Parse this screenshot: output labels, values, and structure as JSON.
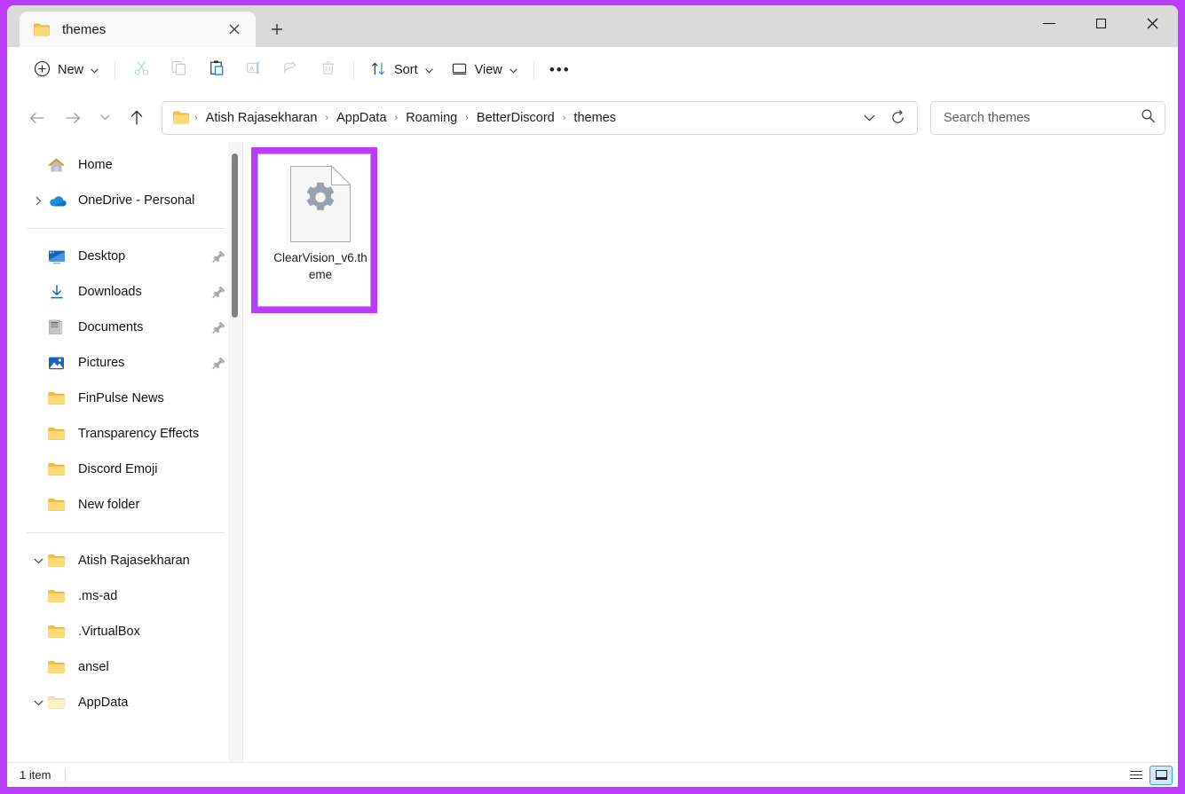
{
  "window": {
    "accent_purple": "#bb3dfb",
    "titlebar_bg": "#dadada",
    "controls": {
      "minimize": "minimize-button",
      "maximize": "maximize-button",
      "close": "close-button"
    }
  },
  "tab": {
    "title": "themes",
    "close_label": "✕",
    "newtab_label": "+"
  },
  "toolbar": {
    "new_label": "New",
    "new_icon": "plus-circle-icon",
    "cut_icon": "scissors-icon",
    "copy_icon": "copy-icon",
    "paste_icon": "paste-icon",
    "rename_icon": "rename-icon",
    "share_icon": "share-icon",
    "delete_icon": "trash-icon",
    "sort_label": "Sort",
    "sort_icon": "sort-arrows-icon",
    "view_label": "View",
    "view_icon": "monitor-icon",
    "more_label": "•••",
    "chevron": "⌄"
  },
  "navigation": {
    "back": "←",
    "forward": "→",
    "recent": "⌄",
    "up": "↑"
  },
  "address": {
    "folder_icon": "folder-icon",
    "crumbs": [
      "Atish Rajasekharan",
      "AppData",
      "Roaming",
      "BetterDiscord",
      "themes"
    ],
    "separator": "›",
    "dropdown_icon": "chevron-down-icon",
    "refresh_icon": "refresh-icon"
  },
  "search": {
    "placeholder": "Search themes",
    "icon": "search-icon"
  },
  "sidebar": {
    "quick_access": [
      {
        "label": "Home",
        "icon": "home-icon",
        "expander": "",
        "pinned": false
      },
      {
        "label": "OneDrive - Personal",
        "icon": "onedrive-cloud-icon",
        "expander": "›",
        "pinned": false
      }
    ],
    "pinned_items": [
      {
        "label": "Desktop",
        "icon": "desktop-icon",
        "pinned": true
      },
      {
        "label": "Downloads",
        "icon": "downloads-icon",
        "pinned": true
      },
      {
        "label": "Documents",
        "icon": "documents-icon",
        "pinned": true
      },
      {
        "label": "Pictures",
        "icon": "pictures-icon",
        "pinned": true
      },
      {
        "label": "FinPulse News",
        "icon": "folder-icon",
        "pinned": false
      },
      {
        "label": "Transparency Effects",
        "icon": "folder-icon",
        "pinned": false
      },
      {
        "label": "Discord Emoji",
        "icon": "folder-icon",
        "pinned": false
      },
      {
        "label": "New folder",
        "icon": "folder-icon",
        "pinned": false
      }
    ],
    "tree": [
      {
        "label": "Atish Rajasekharan",
        "icon": "folder-icon",
        "expander": "⌄",
        "indent": 0
      },
      {
        "label": ".ms-ad",
        "icon": "folder-icon",
        "expander": "",
        "indent": 1
      },
      {
        "label": ".VirtualBox",
        "icon": "folder-icon",
        "expander": "",
        "indent": 1
      },
      {
        "label": "ansel",
        "icon": "folder-icon",
        "expander": "",
        "indent": 1
      },
      {
        "label": "AppData",
        "icon": "folder-hollow-icon",
        "expander": "⌄",
        "indent": 0
      }
    ]
  },
  "content": {
    "files": [
      {
        "name": "ClearVision_v6.theme",
        "icon": "gear-document-icon",
        "selected": true,
        "highlighted": true
      }
    ]
  },
  "statusbar": {
    "item_count": "1 item",
    "details_view_icon": "details-view-icon",
    "large_icons_view_icon": "large-icons-view-icon",
    "active_view": "large-icons-view-icon"
  }
}
